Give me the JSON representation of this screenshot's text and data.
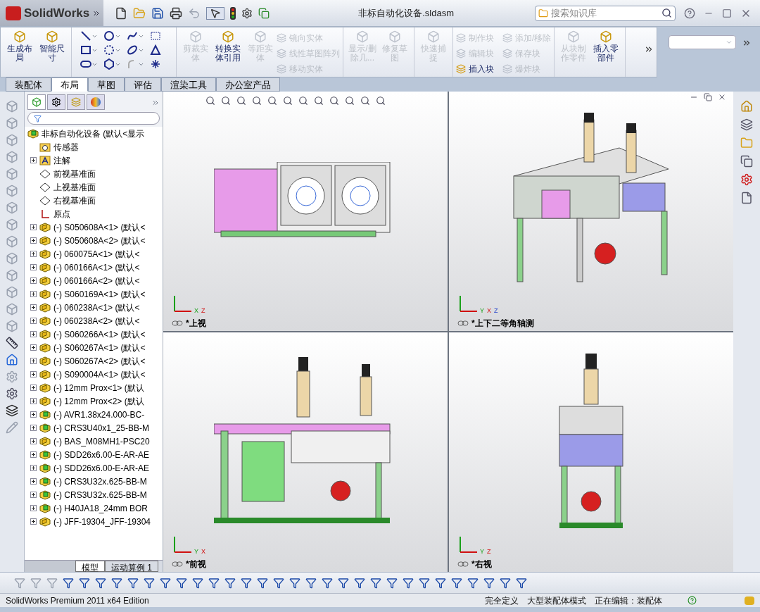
{
  "app": {
    "logo": "SolidWorks",
    "document_title": "非标自动化设备.sldasm",
    "search": {
      "placeholder": "搜索知识库"
    }
  },
  "ribbon": {
    "groups": [
      {
        "items": [
          {
            "label": "生成布局",
            "kind": "big",
            "disabled": false
          },
          {
            "label": "智能尺寸",
            "kind": "big",
            "disabled": false
          }
        ]
      },
      {
        "kind": "sketch_tools"
      },
      {
        "items": [
          {
            "label": "剪裁实体",
            "kind": "big",
            "disabled": true
          },
          {
            "label": "转换实体引用",
            "kind": "big",
            "disabled": false
          },
          {
            "label": "等距实体",
            "kind": "big",
            "disabled": true
          },
          {
            "label": "镜向实体",
            "kind": "small",
            "disabled": true
          },
          {
            "label": "线性草图阵列",
            "kind": "small",
            "disabled": true
          },
          {
            "label": "移动实体",
            "kind": "small",
            "disabled": true
          }
        ]
      },
      {
        "items": [
          {
            "label": "显示/删除几...",
            "kind": "big",
            "disabled": true
          },
          {
            "label": "修复草图",
            "kind": "big",
            "disabled": true
          }
        ]
      },
      {
        "items": [
          {
            "label": "快速捕捉",
            "kind": "big",
            "disabled": true
          }
        ]
      },
      {
        "items": [
          {
            "label": "制作块",
            "kind": "small",
            "disabled": true
          },
          {
            "label": "编辑块",
            "kind": "small",
            "disabled": true
          },
          {
            "label": "插入块",
            "kind": "small",
            "disabled": false
          },
          {
            "label": "添加/移除",
            "kind": "small",
            "disabled": true
          },
          {
            "label": "保存块",
            "kind": "small",
            "disabled": true
          },
          {
            "label": "爆炸块",
            "kind": "small",
            "disabled": true
          }
        ]
      },
      {
        "items": [
          {
            "label": "从块制作零件",
            "kind": "big",
            "disabled": true
          },
          {
            "label": "插入零部件",
            "kind": "big",
            "disabled": false
          }
        ]
      }
    ]
  },
  "command_tabs": [
    {
      "label": "装配体",
      "selected": false
    },
    {
      "label": "布局",
      "selected": true
    },
    {
      "label": "草图",
      "selected": false
    },
    {
      "label": "评估",
      "selected": false
    },
    {
      "label": "渲染工具",
      "selected": false
    },
    {
      "label": "办公室产品",
      "selected": false
    }
  ],
  "feature_tree": {
    "root": {
      "label": "非标自动化设备 (默认<显示",
      "kind": "assembly",
      "children": [
        {
          "label": "传感器",
          "kind": "sensors",
          "expandable": false
        },
        {
          "label": "注解",
          "kind": "annotations",
          "expandable": true
        },
        {
          "label": "前视基准面",
          "kind": "plane",
          "expandable": false
        },
        {
          "label": "上视基准面",
          "kind": "plane",
          "expandable": false
        },
        {
          "label": "右视基准面",
          "kind": "plane",
          "expandable": false
        },
        {
          "label": "原点",
          "kind": "origin",
          "expandable": false
        },
        {
          "label": "(-) S050608A<1> (默认<",
          "kind": "part",
          "expandable": true
        },
        {
          "label": "(-) S050608A<2> (默认<",
          "kind": "part",
          "expandable": true
        },
        {
          "label": "(-) 060075A<1> (默认<",
          "kind": "part",
          "expandable": true
        },
        {
          "label": "(-) 060166A<1> (默认<",
          "kind": "part",
          "expandable": true
        },
        {
          "label": "(-) 060166A<2> (默认<",
          "kind": "part",
          "expandable": true
        },
        {
          "label": "(-) S060169A<1> (默认<",
          "kind": "part",
          "expandable": true
        },
        {
          "label": "(-) 060238A<1> (默认<",
          "kind": "part",
          "expandable": true
        },
        {
          "label": "(-) 060238A<2> (默认<",
          "kind": "part",
          "expandable": true
        },
        {
          "label": "(-) S060266A<1> (默认<",
          "kind": "part",
          "expandable": true
        },
        {
          "label": "(-) S060267A<1> (默认<",
          "kind": "part",
          "expandable": true
        },
        {
          "label": "(-) S060267A<2> (默认<",
          "kind": "part",
          "expandable": true
        },
        {
          "label": "(-) S090004A<1> (默认<",
          "kind": "part",
          "expandable": true
        },
        {
          "label": "(-) 12mm Prox<1> (默认",
          "kind": "part",
          "expandable": true
        },
        {
          "label": "(-) 12mm Prox<2> (默认",
          "kind": "part",
          "expandable": true
        },
        {
          "label": "(-) AVR1.38x24.000-BC-",
          "kind": "assembly",
          "expandable": true
        },
        {
          "label": "(-) CRS3U40x1_25-BB-M",
          "kind": "assembly",
          "expandable": true
        },
        {
          "label": "(-) BAS_M08MH1-PSC20",
          "kind": "part",
          "expandable": true
        },
        {
          "label": "(-) SDD26x6.00-E-AR-AE",
          "kind": "assembly",
          "expandable": true
        },
        {
          "label": "(-) SDD26x6.00-E-AR-AE",
          "kind": "assembly",
          "expandable": true
        },
        {
          "label": "(-) CRS3U32x.625-BB-M",
          "kind": "assembly",
          "expandable": true
        },
        {
          "label": "(-) CRS3U32x.625-BB-M",
          "kind": "assembly",
          "expandable": true
        },
        {
          "label": "(-) H40JA18_24mm BOR",
          "kind": "assembly",
          "expandable": true
        },
        {
          "label": "(-) JFF-19304_JFF-19304",
          "kind": "part",
          "expandable": true
        }
      ]
    }
  },
  "tree_tabs": [
    {
      "label": "模型",
      "selected": true
    },
    {
      "label": "运动算例 1",
      "selected": false
    }
  ],
  "viewports": [
    {
      "label": "*上视",
      "kind": "top",
      "axes": [
        "X",
        "Z"
      ]
    },
    {
      "label": "*上下二等角轴测",
      "kind": "iso",
      "axes": [
        "Y",
        "X",
        "Z"
      ]
    },
    {
      "label": "*前视",
      "kind": "front",
      "axes": [
        "Y",
        "X"
      ]
    },
    {
      "label": "*右视",
      "kind": "right",
      "axes": [
        "Y",
        "Z"
      ]
    }
  ],
  "status_bar": {
    "product": "SolidWorks Premium 2011 x64 Edition",
    "fields": [
      "完全定义",
      "大型装配体模式",
      "正在编辑：装配体"
    ]
  }
}
